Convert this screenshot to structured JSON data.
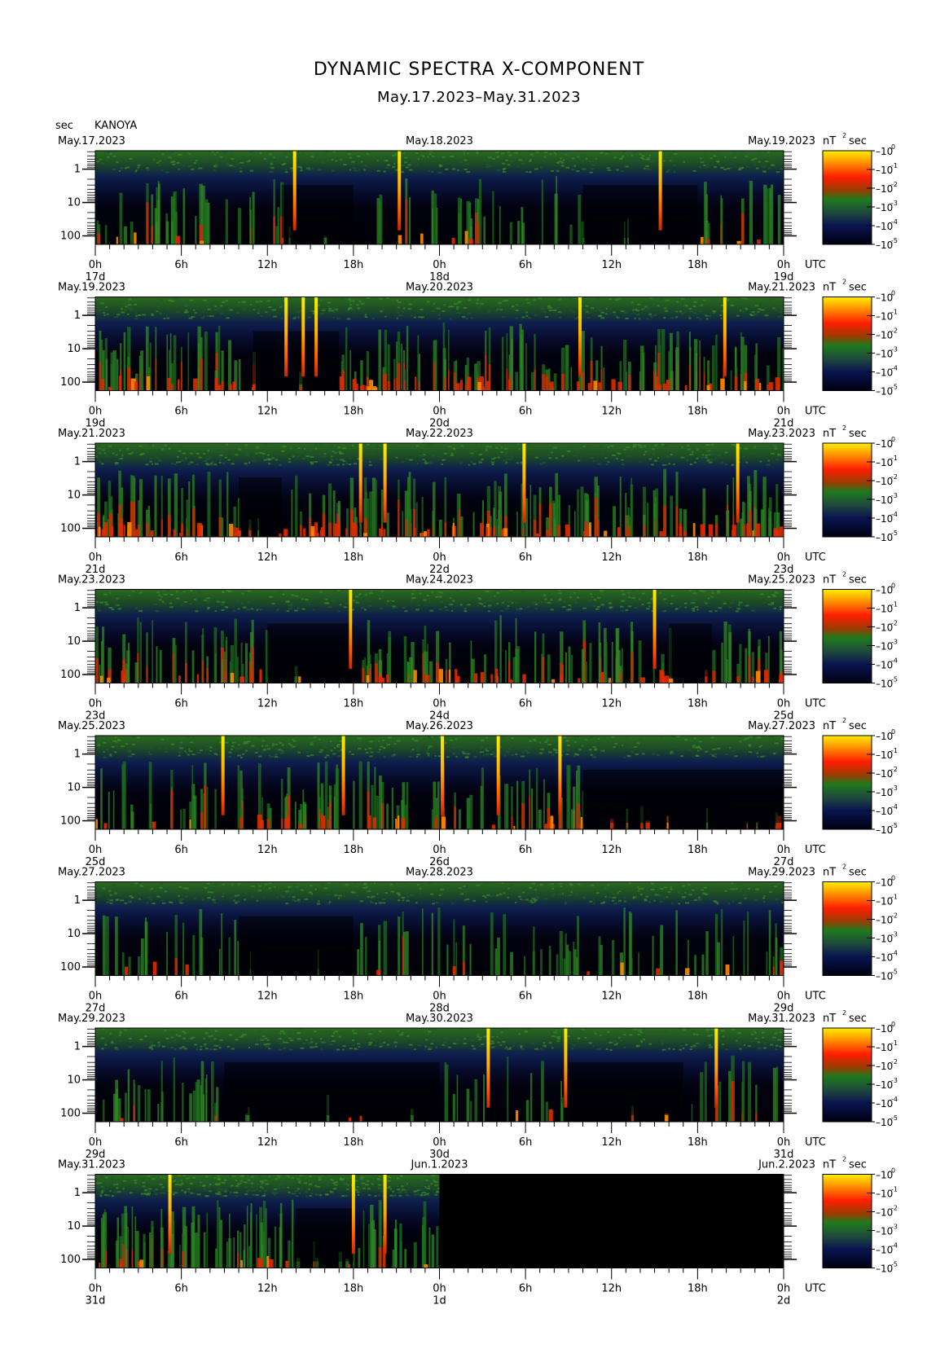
{
  "header": {
    "title": "DYNAMIC SPECTRA X-COMPONENT",
    "subtitle": "May.17.2023–May.31.2023",
    "unit_left": "sec",
    "station": "KANOYA"
  },
  "chart_data": {
    "type": "heatmap",
    "title": "DYNAMIC SPECTRA X-COMPONENT",
    "subtitle": "May.17.2023–May.31.2023",
    "ylabel": "sec",
    "y_scale": "log",
    "y_ticks": [
      "1",
      "10",
      "100"
    ],
    "x_ticks": [
      "0h",
      "6h",
      "12h",
      "18h",
      "0h",
      "6h",
      "12h",
      "18h",
      "0h"
    ],
    "x_suffix": "UTC",
    "colorbar": {
      "unit": "nT",
      "unit_sup": "2",
      "unit_tail": "sec",
      "range": [
        1e-05,
        1
      ],
      "ticks": [
        {
          "base": "10",
          "exp": "0"
        },
        {
          "base": "10",
          "exp": "-1"
        },
        {
          "base": "10",
          "exp": "-2"
        },
        {
          "base": "10",
          "exp": "-3"
        },
        {
          "base": "10",
          "exp": "-4"
        },
        {
          "base": "10",
          "exp": "-5"
        }
      ],
      "colors": [
        "#000022",
        "#0a1a5a",
        "#1e6e1e",
        "#3c9a22",
        "#e62800",
        "#ff8c00",
        "#ffe600"
      ]
    },
    "panels": [
      {
        "start": "May.17.2023",
        "mid": "May.18.2023",
        "end": "May.19.2023",
        "day_labels": [
          "17d",
          "18d",
          "19d"
        ],
        "spikes": [
          13.9,
          21.2,
          39.4
        ],
        "activity": 0.45,
        "quiet": [
          [
            13,
            18
          ],
          [
            34,
            42
          ]
        ],
        "red": 0.12,
        "data_until": 48
      },
      {
        "start": "May.19.2023",
        "mid": "May.20.2023",
        "end": "May.21.2023",
        "day_labels": [
          "19d",
          "20d",
          "21d"
        ],
        "spikes": [
          13.3,
          14.5,
          15.4,
          33.8,
          43.9
        ],
        "activity": 0.6,
        "quiet": [
          [
            11,
            17
          ]
        ],
        "red": 0.45,
        "data_until": 48
      },
      {
        "start": "May.21.2023",
        "mid": "May.22.2023",
        "end": "May.23.2023",
        "day_labels": [
          "21d",
          "22d",
          "23d"
        ],
        "spikes": [
          18.5,
          20.2,
          29.9,
          44.8
        ],
        "activity": 0.7,
        "quiet": [
          [
            10,
            13
          ]
        ],
        "red": 0.5,
        "data_until": 48
      },
      {
        "start": "May.23.2023",
        "mid": "May.24.2023",
        "end": "May.25.2023",
        "day_labels": [
          "23d",
          "24d",
          "25d"
        ],
        "spikes": [
          17.8,
          39.0
        ],
        "activity": 0.6,
        "quiet": [
          [
            12,
            18
          ],
          [
            40,
            43
          ]
        ],
        "red": 0.35,
        "data_until": 48
      },
      {
        "start": "May.25.2023",
        "mid": "May.26.2023",
        "end": "May.27.2023",
        "day_labels": [
          "25d",
          "26d",
          "27d"
        ],
        "spikes": [
          8.9,
          17.3,
          24.2,
          28.1,
          32.4
        ],
        "activity": 0.6,
        "quiet": [
          [
            34,
            48
          ]
        ],
        "red": 0.3,
        "data_until": 48
      },
      {
        "start": "May.27.2023",
        "mid": "May.28.2023",
        "end": "May.29.2023",
        "day_labels": [
          "27d",
          "28d",
          "29d"
        ],
        "spikes": [],
        "activity": 0.4,
        "quiet": [
          [
            10,
            18
          ]
        ],
        "red": 0.08,
        "data_until": 48
      },
      {
        "start": "May.29.2023",
        "mid": "May.30.2023",
        "end": "May.31.2023",
        "day_labels": [
          "29d",
          "30d",
          "31d"
        ],
        "spikes": [
          27.4,
          32.8,
          43.3
        ],
        "activity": 0.45,
        "quiet": [
          [
            9,
            24
          ],
          [
            33,
            41
          ]
        ],
        "red": 0.1,
        "data_until": 48
      },
      {
        "start": "May.31.2023",
        "mid": "Jun.1.2023",
        "end": "Jun.2.2023",
        "day_labels": [
          "31d",
          "1d",
          "2d"
        ],
        "spikes": [
          5.2,
          18.0,
          20.2
        ],
        "activity": 0.45,
        "quiet": [
          [
            14,
            18
          ]
        ],
        "red": 0.1,
        "data_until": 24
      }
    ]
  }
}
